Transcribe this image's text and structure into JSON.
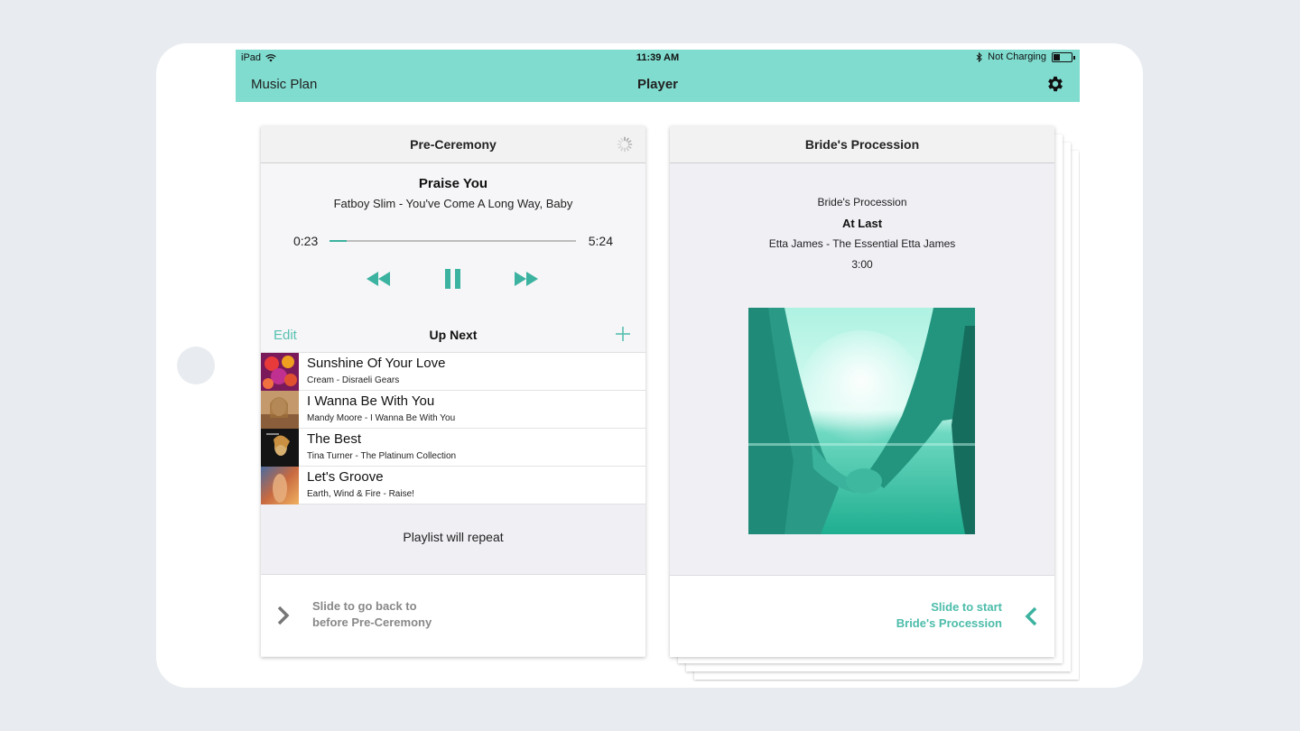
{
  "status_bar": {
    "device": "iPad",
    "time": "11:39 AM",
    "charging": "Not Charging"
  },
  "nav": {
    "left": "Music Plan",
    "title": "Player",
    "settings_icon": "gear-icon"
  },
  "current_segment": {
    "title": "Pre-Ceremony",
    "now_playing": {
      "title": "Praise You",
      "artist_album": "Fatboy Slim - You've Come A Long Way, Baby",
      "elapsed": "0:23",
      "total": "5:24",
      "progress": 0.07
    },
    "up_next": {
      "edit_label": "Edit",
      "title": "Up Next",
      "tracks": [
        {
          "title": "Sunshine Of Your Love",
          "subtitle": "Cream - Disraeli Gears"
        },
        {
          "title": "I Wanna Be With You",
          "subtitle": "Mandy Moore - I Wanna Be With You"
        },
        {
          "title": "The Best",
          "subtitle": "Tina Turner - The Platinum Collection"
        },
        {
          "title": "Let's Groove",
          "subtitle": "Earth, Wind & Fire - Raise!"
        }
      ]
    },
    "repeat_note": "Playlist will repeat",
    "slide_back": {
      "line1": "Slide to go back to",
      "line2": "before Pre-Ceremony"
    }
  },
  "next_segment": {
    "title": "Bride's Procession",
    "subtitle": "Bride's Procession",
    "track_title": "At Last",
    "artist_album": "Etta James - The Essential Etta James",
    "duration": "3:00",
    "slide_start": {
      "line1": "Slide to start",
      "line2": "Bride's Procession"
    }
  },
  "colors": {
    "accent": "#80dccf",
    "accent_dark": "#3cb2a0",
    "teal_text": "#4cbcaa"
  }
}
